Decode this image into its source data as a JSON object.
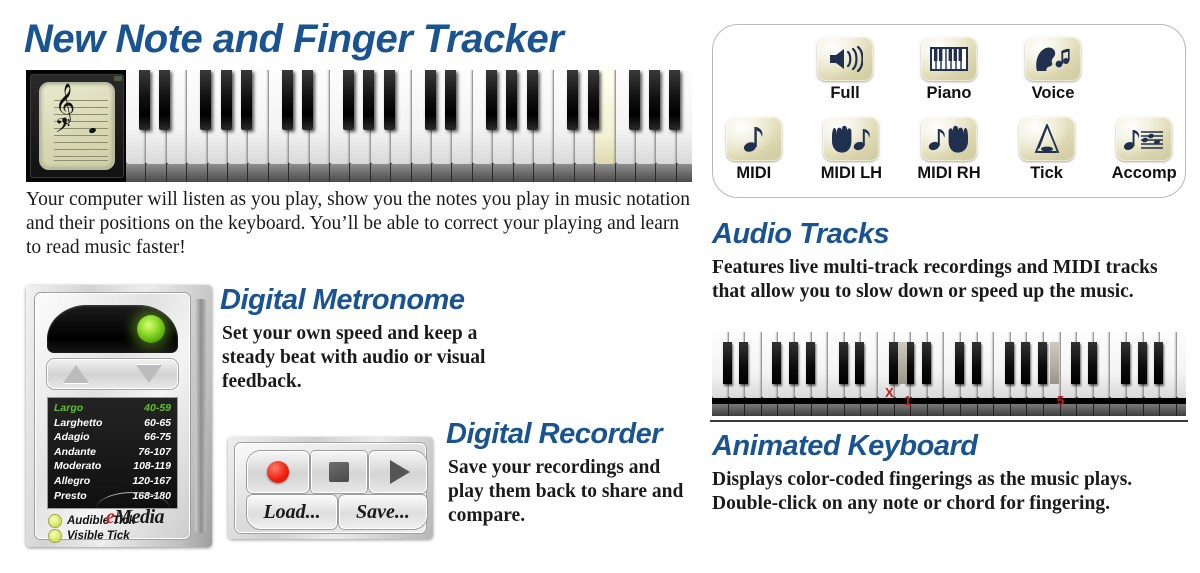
{
  "title": "New Note and Finger Tracker",
  "intro": "Your computer will listen as you play, show you the notes you play in music notation and their positions on the keyboard. You’ll be able to correct your playing and learn to read music faster!",
  "colors": {
    "heading_blue": "#1a5490",
    "tile_cream": "#e3dfbb",
    "icon_navy": "#20304e",
    "led_green": "#8fdc2c",
    "selected_tempo_green": "#5ec12a",
    "record_red": "#ee2211",
    "fingering_red": "#c32025",
    "emedia_red": "#cc1f2a"
  },
  "track_panel": {
    "row1": [
      {
        "label": "Full",
        "icon": "speaker-waves-icon"
      },
      {
        "label": "Piano",
        "icon": "piano-keys-icon"
      },
      {
        "label": "Voice",
        "icon": "singing-head-icon"
      }
    ],
    "row2": [
      {
        "label": "MIDI",
        "icon": "eighth-note-icon"
      },
      {
        "label": "MIDI LH",
        "icon": "left-hand-note-icon"
      },
      {
        "label": "MIDI RH",
        "icon": "right-hand-note-icon"
      },
      {
        "label": "Tick",
        "icon": "metronome-icon"
      },
      {
        "label": "Accomp",
        "icon": "note-staff-icon"
      }
    ]
  },
  "audio_tracks": {
    "heading": "Audio Tracks",
    "body": "Features live multi-track recordings and MIDI tracks that allow you to slow down or speed up the music."
  },
  "animated_keyboard": {
    "heading": "Animated Keyboard",
    "body": "Displays color-coded fingerings as the music plays. Double-click on any note or chord for fingering.",
    "fingering_markers": [
      "X",
      "1",
      "5"
    ]
  },
  "metronome": {
    "heading": "Digital Metronome",
    "body": "Set your own speed and keep a steady beat with audio or visual feedback.",
    "tempos": [
      {
        "name": "Largo",
        "bpm": "40-59",
        "selected": true
      },
      {
        "name": "Larghetto",
        "bpm": "60-65",
        "selected": false
      },
      {
        "name": "Adagio",
        "bpm": "66-75",
        "selected": false
      },
      {
        "name": "Andante",
        "bpm": "76-107",
        "selected": false
      },
      {
        "name": "Moderato",
        "bpm": "108-119",
        "selected": false
      },
      {
        "name": "Allegro",
        "bpm": "120-167",
        "selected": false
      },
      {
        "name": "Presto",
        "bpm": "168-180",
        "selected": false
      }
    ],
    "toggles": [
      {
        "label": "Audible Tick"
      },
      {
        "label": "Visible Tick"
      }
    ],
    "brand_e": "e",
    "brand_rest": "Media"
  },
  "recorder": {
    "heading": "Digital Recorder",
    "body": "Save your recordings and play them back to share and compare.",
    "load_label": "Load...",
    "save_label": "Save..."
  }
}
